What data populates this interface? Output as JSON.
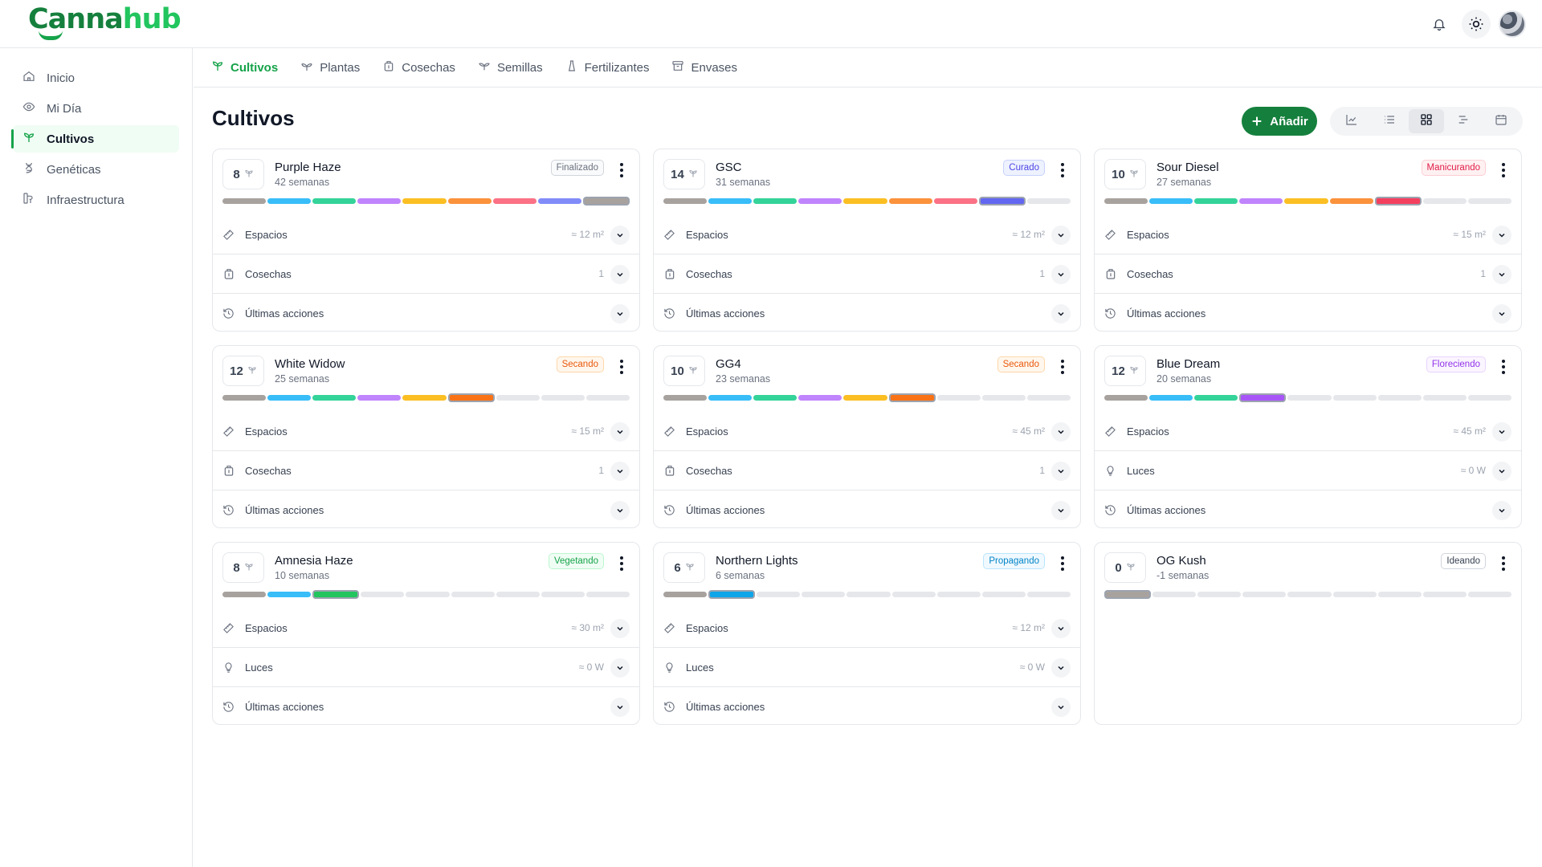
{
  "brand": {
    "name_part1": "Canna",
    "name_part2": "hub"
  },
  "sidebar": {
    "items": [
      {
        "label": "Inicio",
        "icon": "home-icon",
        "active": false
      },
      {
        "label": "Mi Día",
        "icon": "eye-icon",
        "active": false
      },
      {
        "label": "Cultivos",
        "icon": "sprout-icon",
        "active": true
      },
      {
        "label": "Genéticas",
        "icon": "dna-icon",
        "active": false
      },
      {
        "label": "Infraestructura",
        "icon": "infrastructure-icon",
        "active": false
      }
    ]
  },
  "tabs": [
    {
      "label": "Cultivos",
      "icon": "sprout-icon",
      "active": true
    },
    {
      "label": "Plantas",
      "icon": "plant-icon",
      "active": false
    },
    {
      "label": "Cosechas",
      "icon": "harvest-icon",
      "active": false
    },
    {
      "label": "Semillas",
      "icon": "seed-icon",
      "active": false
    },
    {
      "label": "Fertilizantes",
      "icon": "fertilizer-icon",
      "active": false
    },
    {
      "label": "Envases",
      "icon": "box-icon",
      "active": false
    }
  ],
  "page": {
    "title": "Cultivos",
    "add_label": "Añadir"
  },
  "view_options": [
    {
      "name": "chart-view-icon",
      "active": false
    },
    {
      "name": "list-view-icon",
      "active": false
    },
    {
      "name": "grid-view-icon",
      "active": true
    },
    {
      "name": "timeline-view-icon",
      "active": false
    },
    {
      "name": "calendar-view-icon",
      "active": false
    }
  ],
  "stage_colors": [
    "#a8a29e",
    "#38bdf8",
    "#34d399",
    "#c084fc",
    "#fbbf24",
    "#fb923c",
    "#fb7185",
    "#818cf8",
    "#a8a29e"
  ],
  "current_stage_colors": [
    "#a8a29e",
    "#0ea5e9",
    "#22c55e",
    "#a855f7",
    "#f59e0b",
    "#f97316",
    "#f43f5e",
    "#6366f1",
    "#a8a29e"
  ],
  "crops": [
    {
      "name": "Purple Haze",
      "weeks": "42 semanas",
      "plants": "8",
      "status": "Finalizado",
      "status_color": "#6b7280",
      "status_bg": "#f9fafb",
      "status_border": "#d1d5db",
      "stage": 8,
      "rows": [
        {
          "icon": "tape-icon",
          "label": "Espacios",
          "value": "≈ 12 m²"
        },
        {
          "icon": "harvest-icon",
          "label": "Cosechas",
          "value": "1"
        },
        {
          "icon": "history-icon",
          "label": "Últimas acciones",
          "value": ""
        }
      ]
    },
    {
      "name": "GSC",
      "weeks": "31 semanas",
      "plants": "14",
      "status": "Curado",
      "status_color": "#4f46e5",
      "status_bg": "#eef2ff",
      "status_border": "#c7d2fe",
      "stage": 7,
      "rows": [
        {
          "icon": "tape-icon",
          "label": "Espacios",
          "value": "≈ 12 m²"
        },
        {
          "icon": "harvest-icon",
          "label": "Cosechas",
          "value": "1"
        },
        {
          "icon": "history-icon",
          "label": "Últimas acciones",
          "value": ""
        }
      ]
    },
    {
      "name": "Sour Diesel",
      "weeks": "27 semanas",
      "plants": "10",
      "status": "Manicurando",
      "status_color": "#e11d48",
      "status_bg": "#fff1f2",
      "status_border": "#fecdd3",
      "stage": 6,
      "rows": [
        {
          "icon": "tape-icon",
          "label": "Espacios",
          "value": "≈ 15 m²"
        },
        {
          "icon": "harvest-icon",
          "label": "Cosechas",
          "value": "1"
        },
        {
          "icon": "history-icon",
          "label": "Últimas acciones",
          "value": ""
        }
      ]
    },
    {
      "name": "White Widow",
      "weeks": "25 semanas",
      "plants": "12",
      "status": "Secando",
      "status_color": "#ea580c",
      "status_bg": "#fff7ed",
      "status_border": "#fed7aa",
      "stage": 5,
      "rows": [
        {
          "icon": "tape-icon",
          "label": "Espacios",
          "value": "≈ 15 m²"
        },
        {
          "icon": "harvest-icon",
          "label": "Cosechas",
          "value": "1"
        },
        {
          "icon": "history-icon",
          "label": "Últimas acciones",
          "value": ""
        }
      ]
    },
    {
      "name": "GG4",
      "weeks": "23 semanas",
      "plants": "10",
      "status": "Secando",
      "status_color": "#ea580c",
      "status_bg": "#fff7ed",
      "status_border": "#fed7aa",
      "stage": 5,
      "rows": [
        {
          "icon": "tape-icon",
          "label": "Espacios",
          "value": "≈ 45 m²"
        },
        {
          "icon": "harvest-icon",
          "label": "Cosechas",
          "value": "1"
        },
        {
          "icon": "history-icon",
          "label": "Últimas acciones",
          "value": ""
        }
      ]
    },
    {
      "name": "Blue Dream",
      "weeks": "20 semanas",
      "plants": "12",
      "status": "Floreciendo",
      "status_color": "#9333ea",
      "status_bg": "#faf5ff",
      "status_border": "#e9d5ff",
      "stage": 3,
      "rows": [
        {
          "icon": "tape-icon",
          "label": "Espacios",
          "value": "≈ 45 m²"
        },
        {
          "icon": "bulb-icon",
          "label": "Luces",
          "value": "≈ 0 W"
        },
        {
          "icon": "history-icon",
          "label": "Últimas acciones",
          "value": ""
        }
      ]
    },
    {
      "name": "Amnesia Haze",
      "weeks": "10 semanas",
      "plants": "8",
      "status": "Vegetando",
      "status_color": "#16a34a",
      "status_bg": "#f0fdf4",
      "status_border": "#bbf7d0",
      "stage": 2,
      "rows": [
        {
          "icon": "tape-icon",
          "label": "Espacios",
          "value": "≈ 30 m²"
        },
        {
          "icon": "bulb-icon",
          "label": "Luces",
          "value": "≈ 0 W"
        },
        {
          "icon": "history-icon",
          "label": "Últimas acciones",
          "value": ""
        }
      ]
    },
    {
      "name": "Northern Lights",
      "weeks": "6 semanas",
      "plants": "6",
      "status": "Propagando",
      "status_color": "#0284c7",
      "status_bg": "#f0f9ff",
      "status_border": "#bae6fd",
      "stage": 1,
      "rows": [
        {
          "icon": "tape-icon",
          "label": "Espacios",
          "value": "≈ 12 m²"
        },
        {
          "icon": "bulb-icon",
          "label": "Luces",
          "value": "≈ 0 W"
        },
        {
          "icon": "history-icon",
          "label": "Últimas acciones",
          "value": ""
        }
      ]
    },
    {
      "name": "OG Kush",
      "weeks": "-1 semanas",
      "plants": "0",
      "status": "Ideando",
      "status_color": "#374151",
      "status_bg": "#ffffff",
      "status_border": "#d1d5db",
      "stage": 0,
      "rows": []
    }
  ]
}
